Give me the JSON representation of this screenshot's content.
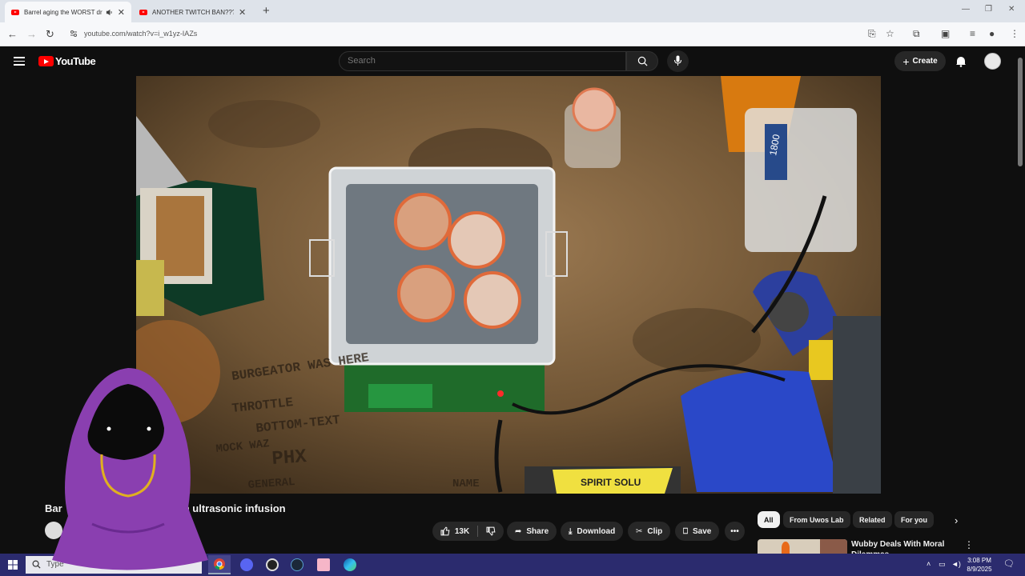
{
  "browser": {
    "tabs": [
      {
        "title": "Barrel aging the WORST dr",
        "active": true,
        "audio": true
      },
      {
        "title": "ANOTHER TWITCH BAN??? - Yo",
        "active": false
      }
    ],
    "url": "youtube.com/watch?v=i_w1yz-IAZs"
  },
  "youtube": {
    "logo_text": "YouTube",
    "search_placeholder": "Search",
    "create_label": "Create"
  },
  "video": {
    "title_visible_start": "Bar",
    "title_visible_end": "with ultrasonic infusion",
    "scene_text": {
      "bottle_label": "1800",
      "table_writing": [
        "BURGEATOR WAS HERE",
        "THROTTLE",
        "BOTTOM-TEXT",
        "PHX",
        "MOCK WAZ",
        "GENERAL",
        "NAME"
      ],
      "sign_text": "SPIRIT SOLU"
    }
  },
  "actions": {
    "likes": "13K",
    "share": "Share",
    "download": "Download",
    "clip": "Clip",
    "save": "Save"
  },
  "chips": [
    "All",
    "From Uwos Lab",
    "Related",
    "For you"
  ],
  "recommendation": {
    "title": "Wubby Deals With Moral Dilemmas"
  },
  "taskbar": {
    "search_placeholder": "Type",
    "time": "3:08 PM",
    "date": "8/9/2025"
  },
  "colors": {
    "yt_red": "#ff0000",
    "page_bg": "#0f0f0f",
    "taskbar": "#2b2b6e",
    "hood_purple": "#8a3fb0"
  }
}
